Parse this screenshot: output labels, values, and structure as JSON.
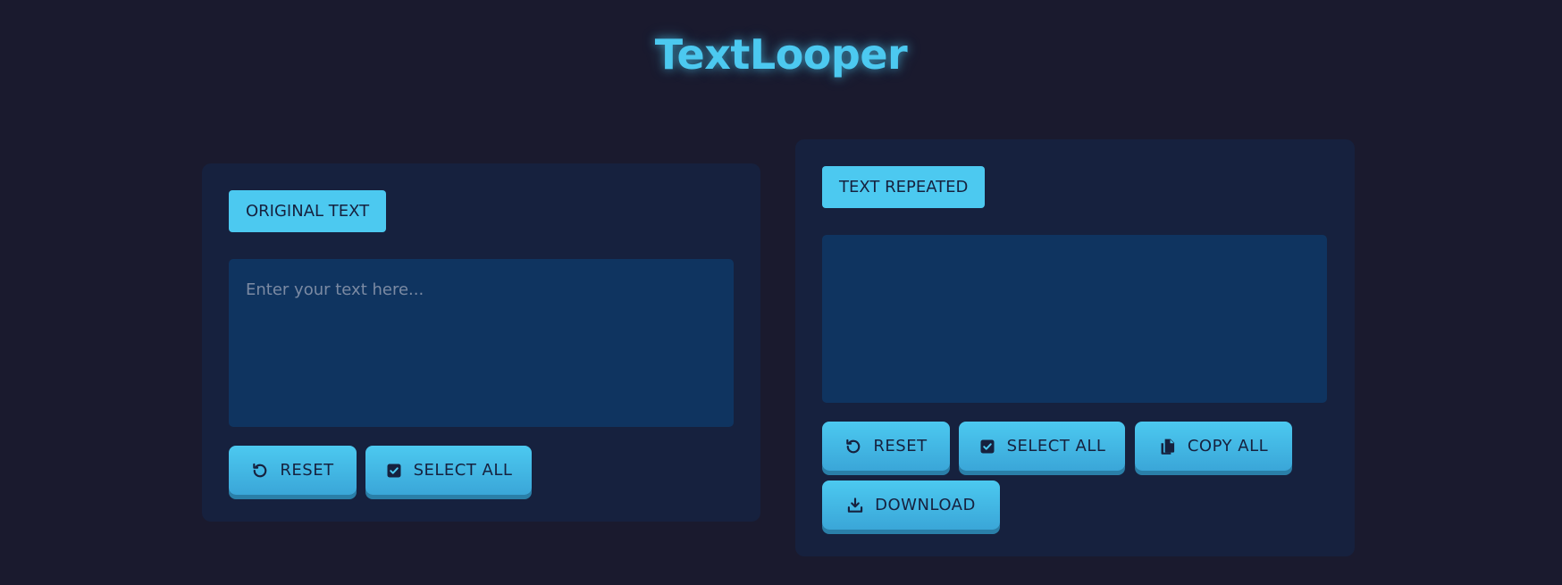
{
  "app": {
    "title": "TextLooper"
  },
  "original": {
    "label": "ORIGINAL TEXT",
    "placeholder": "Enter your text here...",
    "value": "",
    "buttons": {
      "reset": "RESET",
      "select_all": "SELECT ALL"
    }
  },
  "repeated": {
    "label": "TEXT REPEATED",
    "value": "",
    "buttons": {
      "reset": "RESET",
      "select_all": "SELECT ALL",
      "copy_all": "COPY ALL",
      "download": "DOWNLOAD"
    }
  },
  "icons": {
    "reset": "undo-icon",
    "select_all": "checkbox-icon",
    "copy_all": "copy-icon",
    "download": "download-icon"
  },
  "colors": {
    "background": "#1a1a2e",
    "panel": "#16213e",
    "textarea": "#0f3460",
    "accent": "#4cc9f0",
    "button_text": "#16213e"
  }
}
